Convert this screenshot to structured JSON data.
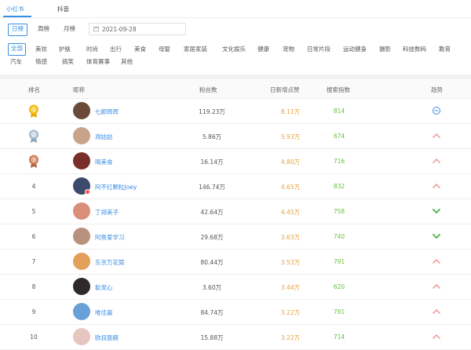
{
  "platform_tabs": [
    {
      "label": "小红书",
      "active": true
    },
    {
      "label": "抖音",
      "active": false
    }
  ],
  "period": {
    "options": [
      {
        "label": "日榜",
        "active": true
      },
      {
        "label": "周榜",
        "active": false
      },
      {
        "label": "月榜",
        "active": false
      }
    ],
    "date": "2021-09-28"
  },
  "categories": [
    {
      "label": "全部",
      "active": true
    },
    {
      "label": "美妆"
    },
    {
      "label": "护肤"
    },
    {
      "label": "时尚"
    },
    {
      "label": "出行"
    },
    {
      "label": "美食"
    },
    {
      "label": "母婴"
    },
    {
      "label": "家居家装"
    },
    {
      "label": "文化娱乐"
    },
    {
      "label": "健康"
    },
    {
      "label": "宠物"
    },
    {
      "label": "日常片段"
    },
    {
      "label": "运动健身"
    },
    {
      "label": "摄影"
    },
    {
      "label": "科技数码"
    },
    {
      "label": "教育"
    },
    {
      "label": "汽车"
    },
    {
      "label": "情感"
    },
    {
      "label": "搞笑"
    },
    {
      "label": "体育赛事"
    },
    {
      "label": "其他"
    }
  ],
  "table": {
    "headers": [
      "排名",
      "昵称",
      "粉丝数",
      "日新增点赞",
      "搜索指数",
      "趋势"
    ],
    "rows": [
      {
        "rank": "1",
        "medal": "gold",
        "nickname": "七颜辉辉",
        "fans": "119.23万",
        "likes": "8.11万",
        "search": "814",
        "trend": "flat",
        "avatar_color": "#6b4a3a"
      },
      {
        "rank": "2",
        "medal": "silver",
        "nickname": "凋姑姑",
        "fans": "5.86万",
        "likes": "5.93万",
        "search": "674",
        "trend": "up",
        "avatar_color": "#c9a48a"
      },
      {
        "rank": "3",
        "medal": "bronze",
        "nickname": "晴美食",
        "fans": "16.14万",
        "likes": "4.80万",
        "search": "716",
        "trend": "up",
        "avatar_color": "#7a2e2a"
      },
      {
        "rank": "4",
        "nickname": "阿不红颗粒Joey",
        "fans": "146.74万",
        "likes": "4.65万",
        "search": "832",
        "trend": "up",
        "avatar_color": "#3c4a6b",
        "vip": true
      },
      {
        "rank": "5",
        "nickname": "丁郑美子",
        "fans": "42.64万",
        "likes": "4.45万",
        "search": "758",
        "trend": "down",
        "avatar_color": "#d98f7a"
      },
      {
        "rank": "6",
        "nickname": "阿鱼爱学习",
        "fans": "29.68万",
        "likes": "3.63万",
        "search": "740",
        "trend": "down",
        "avatar_color": "#b8927c"
      },
      {
        "rank": "7",
        "nickname": "东京万花筒",
        "fans": "80.44万",
        "likes": "3.53万",
        "search": "791",
        "trend": "up",
        "avatar_color": "#e3a05a"
      },
      {
        "rank": "8",
        "nickname": "耿宠心",
        "fans": "3.60万",
        "likes": "3.44万",
        "search": "620",
        "trend": "up",
        "avatar_color": "#2e2a2a"
      },
      {
        "rank": "9",
        "nickname": "唯佳酱",
        "fans": "84.74万",
        "likes": "3.22万",
        "search": "791",
        "trend": "up",
        "avatar_color": "#6aa0d8"
      },
      {
        "rank": "10",
        "nickname": "欧叔面膜",
        "fans": "15.88万",
        "likes": "3.22万",
        "search": "714",
        "trend": "up",
        "avatar_color": "#e8c6c0"
      }
    ]
  },
  "colors": {
    "accent": "#3a8ee6",
    "likes": "#e6a23c",
    "search": "#67c23a",
    "trend_up": "#f0a0a0",
    "trend_down": "#5cb85c",
    "trend_flat": "#3a8ee6"
  }
}
